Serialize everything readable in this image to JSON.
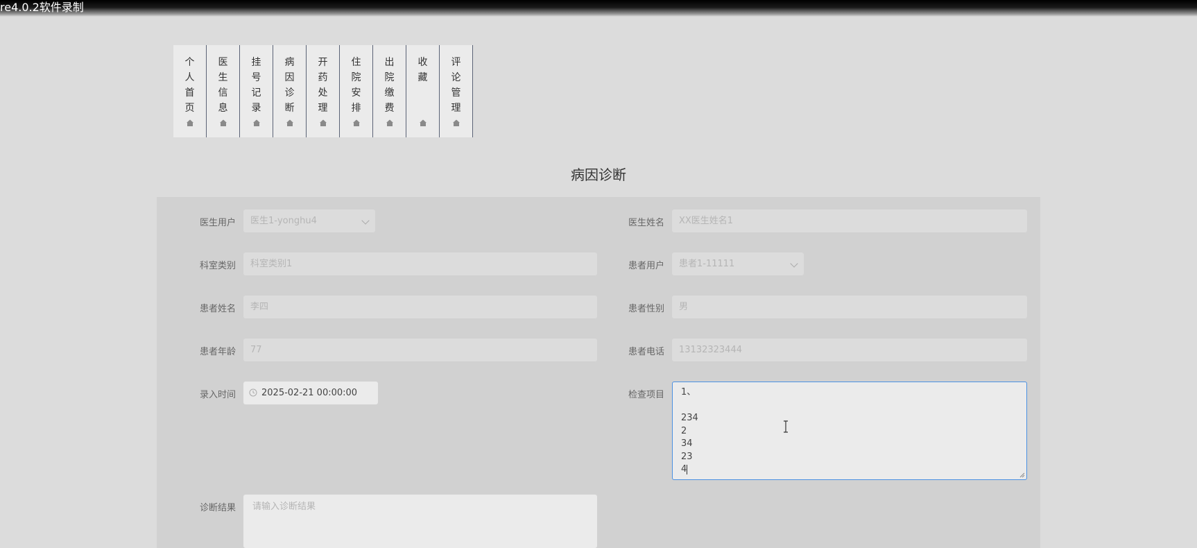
{
  "window": {
    "title": "re4.0.2软件录制"
  },
  "nav": {
    "tabs": [
      {
        "label": "个人首页",
        "icon": "home-icon"
      },
      {
        "label": "医生信息",
        "icon": "home-icon"
      },
      {
        "label": "挂号记录",
        "icon": "home-icon"
      },
      {
        "label": "病因诊断",
        "icon": "home-icon"
      },
      {
        "label": "开药处理",
        "icon": "home-icon"
      },
      {
        "label": "住院安排",
        "icon": "home-icon"
      },
      {
        "label": "出院缴费",
        "icon": "home-icon"
      },
      {
        "label": "收藏",
        "icon": "home-icon"
      },
      {
        "label": "评论管理",
        "icon": "home-icon"
      }
    ]
  },
  "page": {
    "title": "病因诊断"
  },
  "form": {
    "doctor_user": {
      "label": "医生用户",
      "value": "医生1-yonghu4"
    },
    "doctor_name": {
      "label": "医生姓名",
      "value": "XX医生姓名1"
    },
    "department": {
      "label": "科室类别",
      "value": "科室类别1"
    },
    "patient_user": {
      "label": "患者用户",
      "value": "患者1-11111"
    },
    "patient_name": {
      "label": "患者姓名",
      "value": "李四"
    },
    "patient_gender": {
      "label": "患者性别",
      "value": "男"
    },
    "patient_age": {
      "label": "患者年龄",
      "value": "77"
    },
    "patient_phone": {
      "label": "患者电话",
      "value": "13132323444"
    },
    "entry_time": {
      "label": "录入时间",
      "value": "2025-02-21 00:00:00"
    },
    "exam_items": {
      "label": "检查项目",
      "value": "1、\n\n234\n2\n34\n23\n4"
    },
    "diagnosis": {
      "label": "诊断结果",
      "placeholder": "请输入诊断结果"
    }
  },
  "colors": {
    "focus_border": "#4a90e2",
    "panel_bg": "#d1d1d1",
    "page_bg": "#dcdcdc"
  }
}
